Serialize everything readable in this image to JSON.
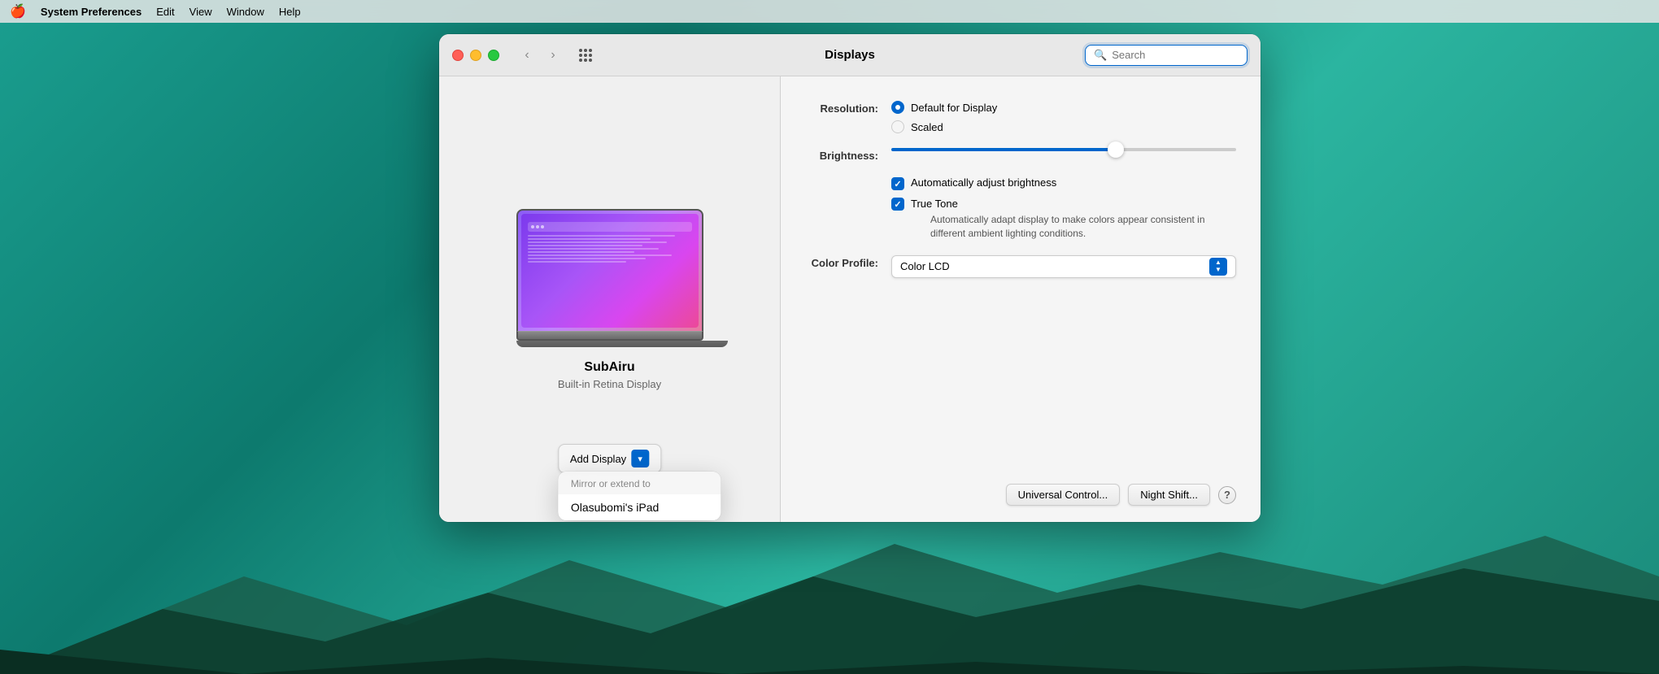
{
  "menubar": {
    "apple": "🍎",
    "items": [
      {
        "label": "System Preferences",
        "bold": true
      },
      {
        "label": "Edit"
      },
      {
        "label": "View"
      },
      {
        "label": "Window"
      },
      {
        "label": "Help"
      }
    ]
  },
  "window": {
    "title": "Displays",
    "search_placeholder": "Search"
  },
  "left_panel": {
    "display_name": "SubAiru",
    "display_subtitle": "Built-in Retina Display",
    "add_display_label": "Add Display"
  },
  "dropdown": {
    "header": "Mirror or extend to",
    "item": "Olasubomi's iPad"
  },
  "right_panel": {
    "resolution_label": "Resolution:",
    "resolution_default": "Default for Display",
    "resolution_scaled": "Scaled",
    "brightness_label": "Brightness:",
    "auto_brightness": "Automatically adjust brightness",
    "true_tone": "True Tone",
    "true_tone_desc": "Automatically adapt display to make colors appear consistent in different ambient lighting conditions.",
    "color_profile_label": "Color Profile:",
    "color_profile_value": "Color LCD",
    "universal_control_btn": "Universal Control...",
    "night_shift_btn": "Night Shift...",
    "help_label": "?"
  }
}
